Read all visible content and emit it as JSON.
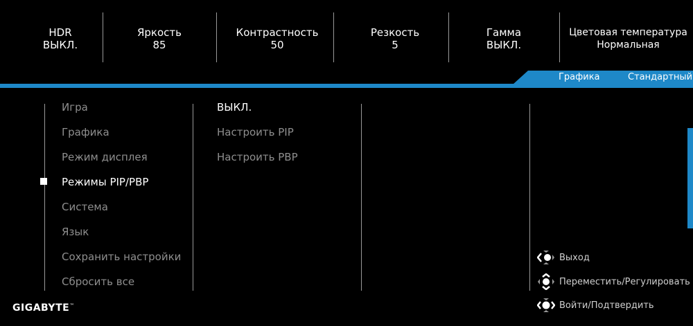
{
  "status_bar": [
    {
      "label": "HDR",
      "value": "ВЫКЛ."
    },
    {
      "label": "Яркость",
      "value": "85"
    },
    {
      "label": "Контрастность",
      "value": "50"
    },
    {
      "label": "Резкость",
      "value": "5"
    },
    {
      "label": "Гамма",
      "value": "ВЫКЛ."
    },
    {
      "label": "Цветовая температура",
      "value": "Нормальная"
    }
  ],
  "mode_tab": {
    "category": "Графика",
    "preset": "Стандартный"
  },
  "main_menu": [
    "Игра",
    "Графика",
    "Режим дисплея",
    "Режимы PIP/PBP",
    "Система",
    "Язык",
    "Сохранить настройки",
    "Сбросить все"
  ],
  "main_menu_selected": "Режимы PIP/PBP",
  "sub_menu": [
    "ВЫКЛ.",
    "Настроить PIP",
    "Настроить PBP"
  ],
  "sub_menu_selected": "ВЫКЛ.",
  "hints": [
    {
      "icon": "joystick-left-icon",
      "label": "Выход"
    },
    {
      "icon": "joystick-updown-icon",
      "label": "Переместить/Регулировать"
    },
    {
      "icon": "joystick-press-icon",
      "label": "Войти/Подтвердить"
    }
  ],
  "brand": {
    "name": "GIGABYTE",
    "mark": "™"
  },
  "colors": {
    "accent": "#1e88c8",
    "background": "#000000",
    "text_inactive": "#8e8e8e"
  }
}
